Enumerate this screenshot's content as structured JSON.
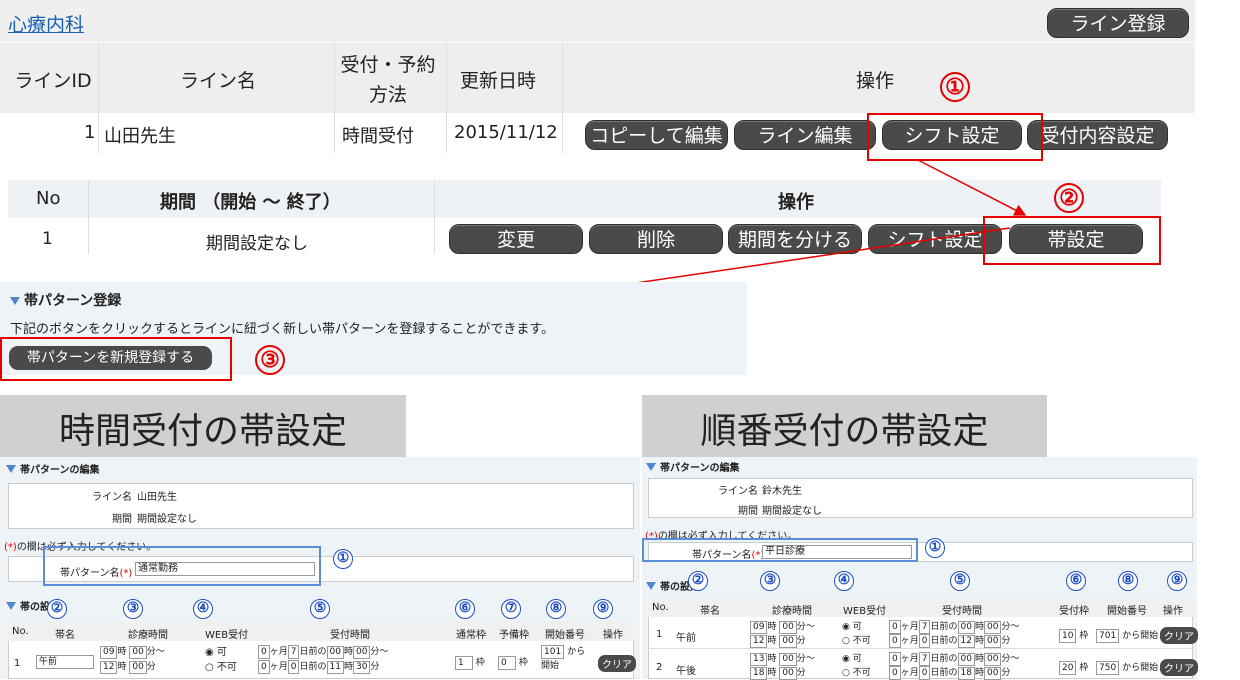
{
  "dept": {
    "title": "心療内科",
    "register_button": "ライン登録"
  },
  "line_table": {
    "headers": [
      "ラインID",
      "ライン名",
      "受付・予約方法",
      "更新日時",
      "操作"
    ],
    "row": {
      "id": "1",
      "name": "山田先生",
      "method": "時間受付",
      "updated": "2015/11/12"
    },
    "buttons": [
      "コピーして編集",
      "ライン編集",
      "シフト設定",
      "受付内容設定"
    ]
  },
  "period_table": {
    "headers": [
      "No",
      "期間 （開始 ～ 終了）",
      "操作"
    ],
    "row": {
      "no": "1",
      "period": "期間設定なし"
    },
    "buttons": [
      "変更",
      "削除",
      "期間を分ける",
      "シフト設定",
      "帯設定"
    ]
  },
  "band_register": {
    "title": "帯パターン登録",
    "desc": "下記のボタンをクリックするとラインに紐づく新しい帯パターンを登録することができます。",
    "button": "帯パターンを新規登録する"
  },
  "steps": [
    "①",
    "②",
    "③"
  ],
  "left": {
    "caption": "時間受付の帯設定",
    "edit_title": "帯パターンの編集",
    "line_label": "ライン名",
    "line_value": "山田先生",
    "period_label": "期間",
    "period_value": "期間設定なし",
    "required_note": "の欄は必ず入力してください。",
    "pattern_label": "帯パターン名",
    "pattern_value": "通常勤務",
    "band_title": "帯の設定",
    "headers": [
      "No.",
      "帯名",
      "診療時間",
      "WEB受付",
      "受付時間",
      "通常枠",
      "予備枠",
      "開始番号",
      "操作"
    ],
    "row": {
      "no": "1",
      "name": "午前",
      "t1h": "09",
      "t1m": "00",
      "t2h": "12",
      "t2m": "00",
      "web_yes": "可",
      "web_no": "不可",
      "m1": "0",
      "d1": "7",
      "h1": "00",
      "mm1": "00",
      "m2": "0",
      "d2": "0",
      "h2": "11",
      "mm2": "30",
      "normal": "1",
      "reserve": "0",
      "start": "101",
      "start_suffix": "から開始",
      "clear": "クリア"
    }
  },
  "right": {
    "caption": "順番受付の帯設定",
    "edit_title": "帯パターンの編集",
    "line_label": "ライン名",
    "line_value": "鈴木先生",
    "period_label": "期間",
    "period_value": "期間設定なし",
    "required_note": "の欄は必ず入力してください。",
    "pattern_label": "帯パターン名",
    "pattern_value": "平日診療",
    "band_title": "帯の設定",
    "headers": [
      "No.",
      "帯名",
      "診療時間",
      "WEB受付",
      "受付時間",
      "受付枠",
      "開始番号",
      "操作"
    ],
    "rows": [
      {
        "no": "1",
        "name": "午前",
        "t1h": "09",
        "t1m": "00",
        "t2h": "12",
        "t2m": "00",
        "m1": "0",
        "d1": "7",
        "h1": "00",
        "mm1": "00",
        "m2": "0",
        "d2": "0",
        "h2": "12",
        "mm2": "00",
        "slots": "10",
        "start": "701",
        "start_suffix": "から開始"
      },
      {
        "no": "2",
        "name": "午後",
        "t1h": "13",
        "t1m": "00",
        "t2h": "18",
        "t2m": "00",
        "m1": "0",
        "d1": "7",
        "h1": "00",
        "mm1": "00",
        "m2": "0",
        "d2": "0",
        "h2": "18",
        "mm2": "00",
        "slots": "20",
        "start": "750",
        "start_suffix": "から開始"
      }
    ],
    "web_yes": "可",
    "web_no": "不可",
    "clear": "クリア"
  },
  "labels": {
    "ji": "時",
    "fun_kara": "分～",
    "fun": "分",
    "kagetsu": "ヶ月",
    "nichimae": "日前の",
    "waku": "枠",
    "req": "(*)"
  },
  "blue_nums": [
    "①",
    "②",
    "③",
    "④",
    "⑤",
    "⑥",
    "⑦",
    "⑧",
    "⑨"
  ]
}
